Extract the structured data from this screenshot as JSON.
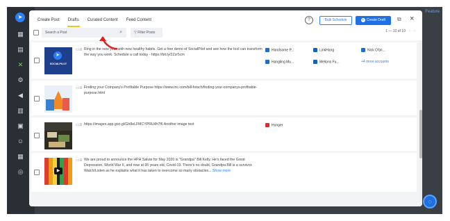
{
  "bg": {
    "corner_text": "Feature"
  },
  "modal": {
    "tabs": [
      "Create Post",
      "Drafts",
      "Curated Content",
      "Feed Content"
    ],
    "active_tab": "Drafts",
    "bulk_schedule": "Bulk Schedule",
    "create_draft": "Create Draft",
    "search_placeholder": "Search a Post",
    "filter_label": "Filter Posts",
    "pagination": "1 — 10 of 10",
    "prev": "‹",
    "next": "›"
  },
  "posts": [
    {
      "type": "text-image",
      "thumb_label": "SOCIALPILOT",
      "text": "Ring in the new year with new healthy habits. Get a free demo of SocialPilot and see how the tool can transform the way you work. Schedule a call today - https://bit.ly/2Zzr5cm",
      "accounts": [
        {
          "name": "Handsome P...",
          "color": "#1d6fcf"
        },
        {
          "name": "LinkHang",
          "color": "#0a66c2"
        },
        {
          "name": "Nick O'bri...",
          "color": "#1d6fcf"
        },
        {
          "name": "Hangling Mu...",
          "color": "#1d6fcf"
        },
        {
          "name": "Mellons Fu...",
          "color": "#0a66c2"
        }
      ],
      "more_accounts": "+4 more accounts"
    },
    {
      "type": "text-image",
      "text": "Finding your Company's Profitable Purpose https://www.inc.com/bill-fotsch/finding-your-companys-profitable-purpose.html",
      "accounts": []
    },
    {
      "type": "text-image",
      "text": "https://images.app.goo.gl/Gh8eLFMCYPRU4h7f6 Another image test",
      "accounts": [
        {
          "name": "Hunger",
          "color": "#e02c2c"
        }
      ]
    },
    {
      "type": "text-video",
      "text": "We are proud to announce the HPH Salute for May 2020 is \"Grandpa\" Bill Kelly. He's faced the Great Depression, World War II, and now at 95 years old, Covid-19. There's no doubt, Grandpa Bill is a survivor. Watch/Listen as he explains what it has taken to overcome so many obstacles...",
      "show_more": "Show more",
      "accounts": []
    }
  ]
}
